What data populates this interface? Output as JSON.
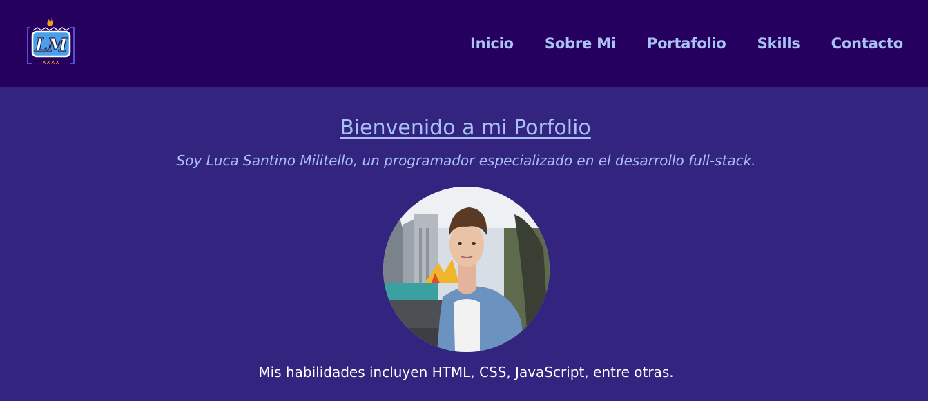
{
  "header": {
    "logo_text": "LM",
    "nav": [
      {
        "label": "Inicio"
      },
      {
        "label": "Sobre Mi"
      },
      {
        "label": "Portafolio"
      },
      {
        "label": "Skills"
      },
      {
        "label": "Contacto"
      }
    ]
  },
  "hero": {
    "title": "Bienvenido a mi Porfolio",
    "subtitle": "Soy Luca Santino Militello, un programador especializado en el desarrollo full-stack.",
    "skills_text": "Mis habilidades incluyen HTML, CSS, JavaScript, entre otras."
  },
  "colors": {
    "header_bg": "#25005f",
    "page_bg": "#33247f",
    "link": "#a9c1f4",
    "text": "#ffffff"
  }
}
